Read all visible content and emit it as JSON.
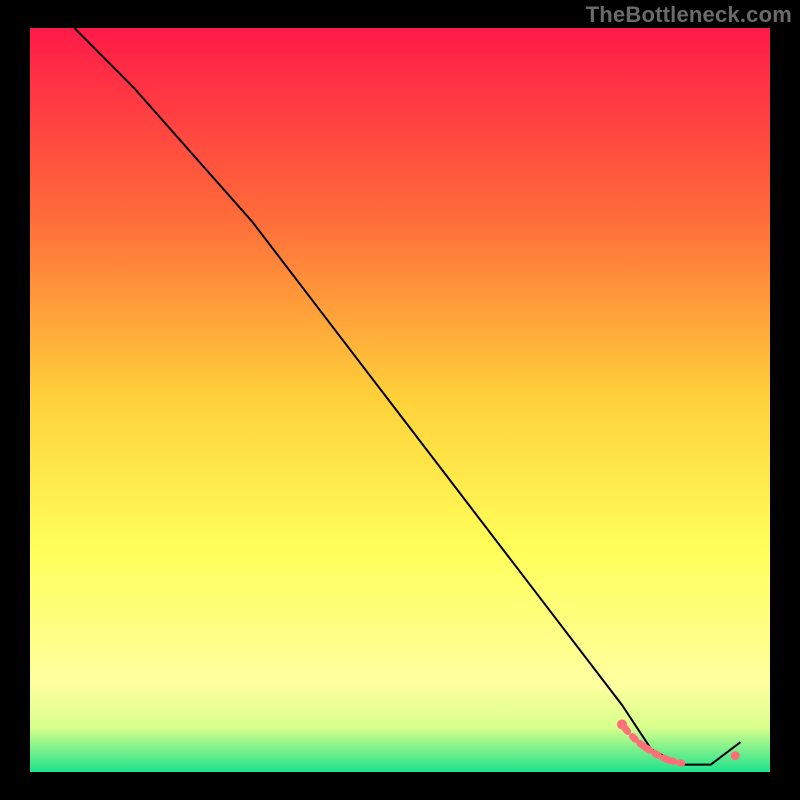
{
  "watermark": "TheBottleneck.com",
  "chart_data": {
    "type": "line",
    "title": "",
    "xlabel": "",
    "ylabel": "",
    "xlim": [
      0,
      100
    ],
    "ylim": [
      0,
      100
    ],
    "grid": false,
    "legend": false,
    "gradient_stops": [
      {
        "offset": 0,
        "color": "#ff1a48"
      },
      {
        "offset": 25,
        "color": "#ff6a3a"
      },
      {
        "offset": 50,
        "color": "#ffd23a"
      },
      {
        "offset": 70,
        "color": "#ffff5a"
      },
      {
        "offset": 88,
        "color": "#ffffa0"
      },
      {
        "offset": 94,
        "color": "#d8ff8c"
      },
      {
        "offset": 100,
        "color": "#1de28c"
      }
    ],
    "series": [
      {
        "name": "bottleneck-curve",
        "color": "#000000",
        "x": [
          6,
          14,
          22,
          30,
          40,
          50,
          60,
          70,
          80,
          84,
          88,
          92,
          96
        ],
        "y": [
          100,
          92,
          83,
          74,
          61,
          48,
          35,
          22,
          9,
          3,
          1,
          1,
          4
        ]
      }
    ],
    "overlay_points": {
      "name": "dashed-pink-run",
      "color": "#ff6f77",
      "x": [
        80.0,
        80.8,
        82.0,
        83.0,
        84.3,
        85.3,
        86.3,
        87.5,
        88.5,
        89.5,
        90.5,
        91.7,
        92.8,
        94.0,
        95.3
      ],
      "y": [
        6.4,
        5.4,
        4.2,
        3.4,
        2.6,
        2.0,
        1.6,
        1.3,
        1.1,
        1.0,
        1.0,
        1.0,
        1.0,
        1.1,
        1.3
      ]
    }
  }
}
